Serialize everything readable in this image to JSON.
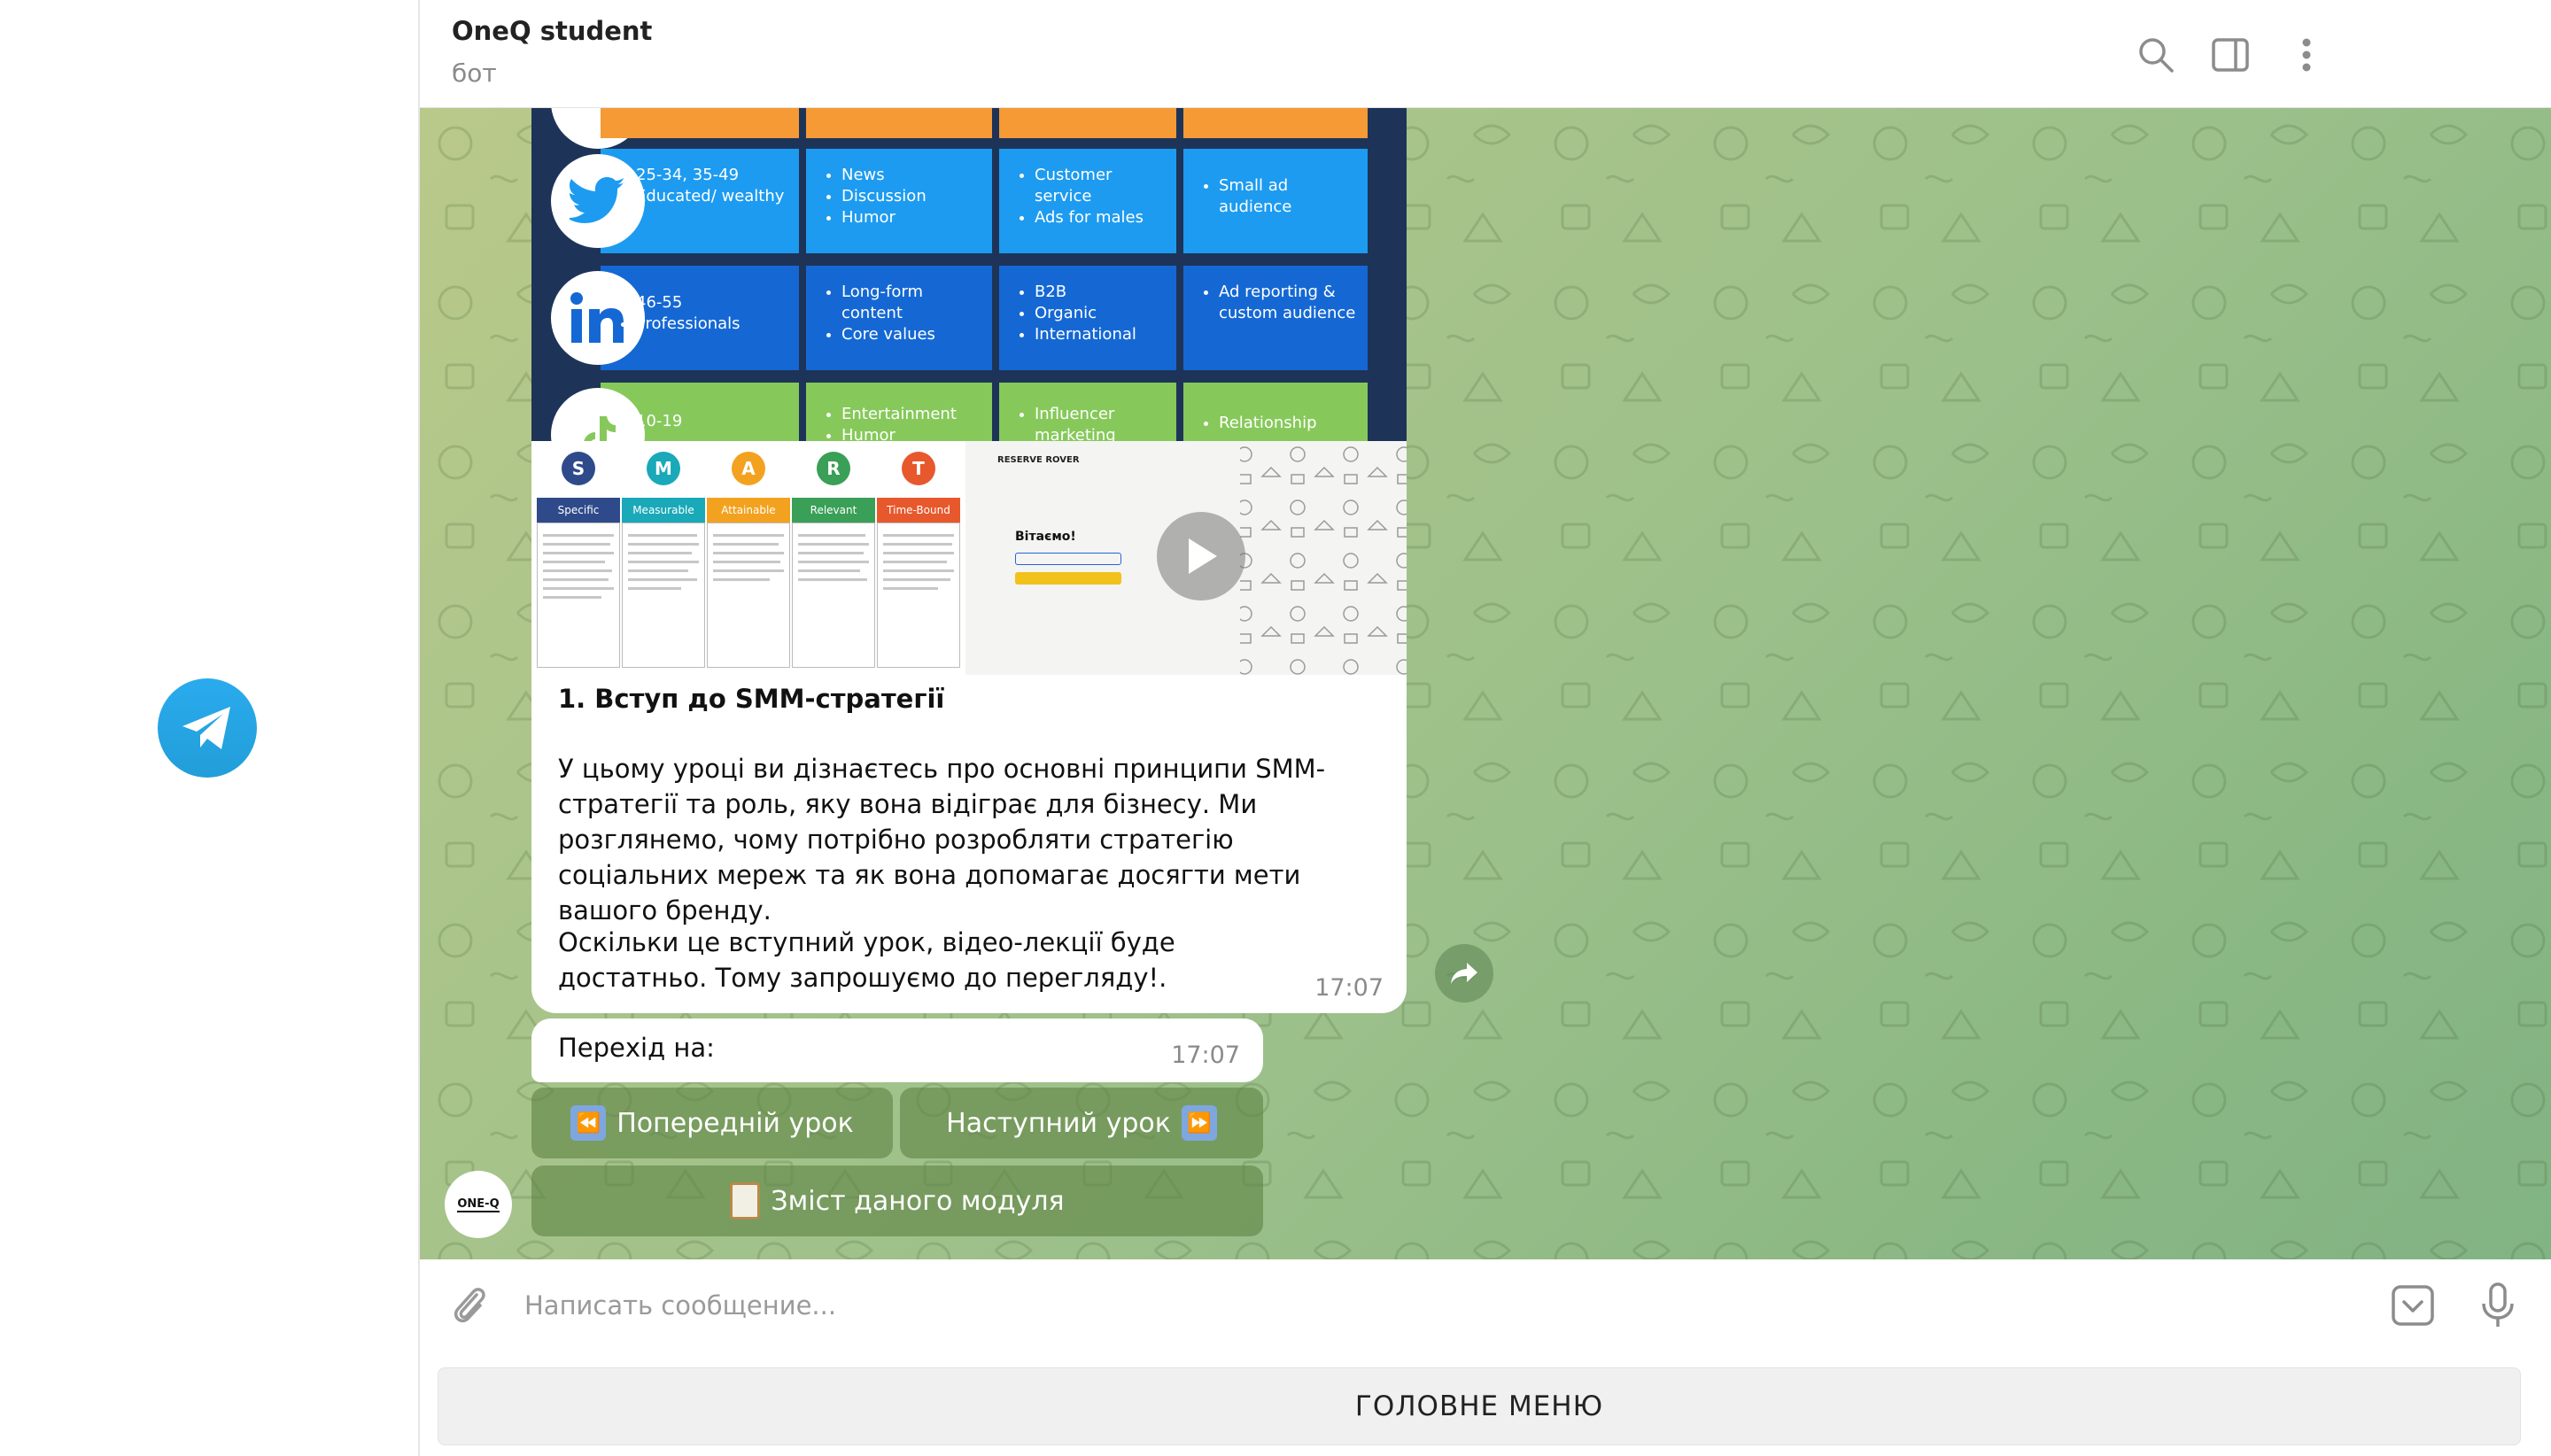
{
  "header": {
    "title": "OneQ student",
    "subtitle": "бот"
  },
  "infographic": {
    "rows": [
      {
        "platform": "twitter",
        "cells": [
          [
            "25-34, 35-49",
            "Educated/ wealthy"
          ],
          [
            "News",
            "Discussion",
            "Humor"
          ],
          [
            "Customer service",
            "Ads for males"
          ],
          [
            "Small ad audience"
          ]
        ]
      },
      {
        "platform": "linkedin",
        "cells": [
          [
            "46-55",
            "Professionals"
          ],
          [
            "Long-form content",
            "Core values"
          ],
          [
            "B2B",
            "Organic",
            "International"
          ],
          [
            "Ad reporting & custom audience"
          ]
        ]
      },
      {
        "platform": "tiktok",
        "cells": [
          [
            "10-19"
          ],
          [
            "Entertainment",
            "Humor"
          ],
          [
            "Influencer marketing"
          ],
          [
            "Relationship"
          ]
        ]
      }
    ]
  },
  "smart": {
    "letters": [
      "S",
      "M",
      "A",
      "R",
      "T"
    ],
    "headers": [
      "Specific",
      "Measurable",
      "Attainable",
      "Relevant",
      "Time-Bound"
    ],
    "colors": [
      "#2f4a8a",
      "#19a9b8",
      "#f3a21f",
      "#3a9f57",
      "#e8582d"
    ]
  },
  "video": {
    "brand": "RESERVE ROVER",
    "greeting": "Вітаємо!"
  },
  "lesson": {
    "title": "1. Вступ до SMM-стратегії",
    "paragraph1": "У цьому уроці ви дізнаєтесь про основні принципи SMM-стратегії та роль, яку вона відіграє для бізнесу. Ми розглянемо, чому потрібно розробляти стратегію соціальних мереж та як вона допомагає досягти мети вашого бренду.",
    "paragraph2": "Оскільки це вступний урок, відео-лекції буде достатньо. Тому запрошуємо до перегляду!.",
    "time": "17:07"
  },
  "nav_message": {
    "text": "Перехід на:",
    "time": "17:07"
  },
  "keyboard": {
    "prev_label": "Попередній урок",
    "next_label": "Наступний урок",
    "contents_label": "Зміст даного модуля"
  },
  "avatar": {
    "text": "ONE-Q"
  },
  "input": {
    "placeholder": "Написать сообщение..."
  },
  "menu": {
    "main_label": "ГОЛОВНЕ МЕНЮ"
  },
  "colors": {
    "telegram_blue": "#2aabee",
    "keyboard_button": "#60844680"
  }
}
